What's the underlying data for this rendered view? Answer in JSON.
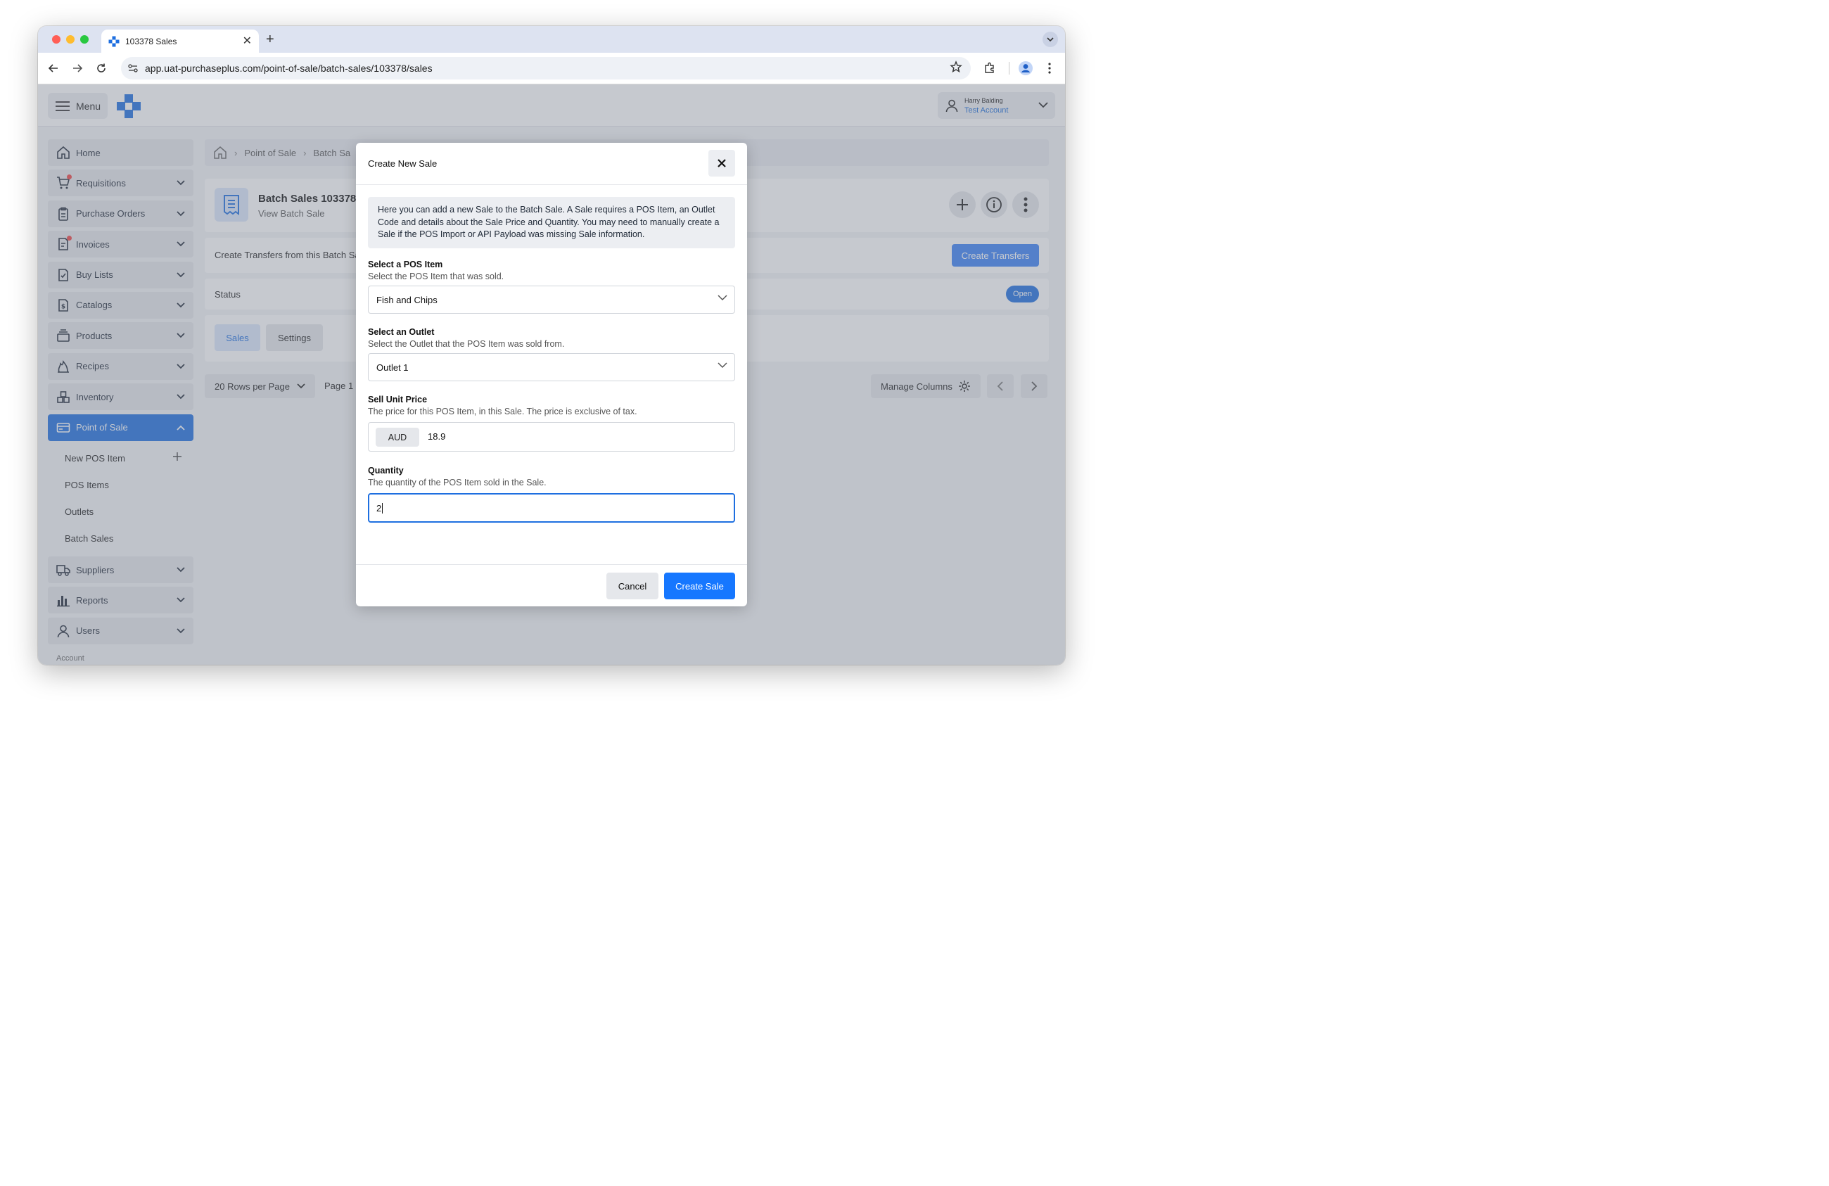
{
  "browser": {
    "tab_title": "103378 Sales",
    "url_host": "app.uat-purchaseplus.com",
    "url_path": "/point-of-sale/batch-sales/103378/sales"
  },
  "header": {
    "menu_label": "Menu",
    "user_name": "Harry Balding",
    "user_account": "Test Account"
  },
  "sidebar": {
    "items": [
      {
        "label": "Home",
        "icon": "home-icon"
      },
      {
        "label": "Requisitions",
        "icon": "cart-icon"
      },
      {
        "label": "Purchase Orders",
        "icon": "clipboard-icon"
      },
      {
        "label": "Invoices",
        "icon": "invoice-icon"
      },
      {
        "label": "Buy Lists",
        "icon": "checklist-icon"
      },
      {
        "label": "Catalogs",
        "icon": "dollar-doc-icon"
      },
      {
        "label": "Products",
        "icon": "stack-icon"
      },
      {
        "label": "Recipes",
        "icon": "flame-icon"
      },
      {
        "label": "Inventory",
        "icon": "boxes-icon"
      },
      {
        "label": "Point of Sale",
        "icon": "card-icon"
      },
      {
        "label": "Suppliers",
        "icon": "truck-icon"
      },
      {
        "label": "Reports",
        "icon": "bar-chart-icon"
      },
      {
        "label": "Users",
        "icon": "user-icon"
      }
    ],
    "pos_sub": [
      "New POS Item",
      "POS Items",
      "Outlets",
      "Batch Sales"
    ],
    "more_label": "Account"
  },
  "breadcrumb": {
    "items": [
      "Point of Sale",
      "Batch Sa"
    ]
  },
  "page": {
    "title": "Batch Sales 103378",
    "subtitle": "View Batch Sale",
    "transfers_text": "Create Transfers from this Batch Sa",
    "transfers_button": "Create Transfers",
    "status_label": "Status",
    "status_value": "Open",
    "tabs": [
      "Sales",
      "Settings"
    ],
    "rows_per_page": "20 Rows per Page",
    "page_label": "Page 1 c",
    "manage_columns": "Manage Columns"
  },
  "modal": {
    "title": "Create New Sale",
    "info": "Here you can add a new Sale to the Batch Sale. A Sale requires a POS Item, an Outlet Code and details about the Sale Price and Quantity. You may need to manually create a Sale if the POS Import or API Payload was missing Sale information.",
    "pos_item_label": "Select a POS Item",
    "pos_item_help": "Select the POS Item that was sold.",
    "pos_item_value": "Fish and Chips",
    "outlet_label": "Select an Outlet",
    "outlet_help": "Select the Outlet that the POS Item was sold from.",
    "outlet_value": "Outlet 1",
    "price_label": "Sell Unit Price",
    "price_help": "The price for this POS Item, in this Sale. The price is exclusive of tax.",
    "currency": "AUD",
    "price_value": "18.9",
    "qty_label": "Quantity",
    "qty_help": "The quantity of the POS Item sold in the Sale.",
    "qty_value": "2",
    "cancel_label": "Cancel",
    "create_label": "Create Sale"
  },
  "colors": {
    "accent": "#1e6fe0",
    "primary_button": "#1677ff",
    "notification_dot": "#ef4444"
  }
}
